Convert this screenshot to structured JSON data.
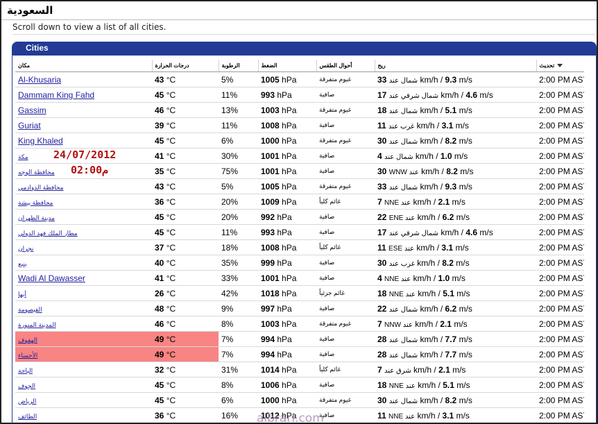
{
  "page": {
    "title": "السعودية",
    "notice": "Scroll down to view a list of all cities.",
    "panel_title": "Cities"
  },
  "columns": {
    "city": "مكان",
    "temp": "درجات الحرارة",
    "humidity": "الرطوبة",
    "pressure": "الضغط",
    "weather": "أحوال الطقس",
    "wind": "ريح",
    "updated": "تحديث"
  },
  "overlay": {
    "date": "24/07/2012",
    "time": "02:00م"
  },
  "watermark": "albrari.com",
  "colors": {
    "panel_header": "#233b95",
    "highlight": "#f88484",
    "link": "#2121a0",
    "overlay_text": "#b01010"
  },
  "rows": [
    {
      "city": "Al-Khusaria",
      "arabic": false,
      "temp": "43",
      "humidity": "5%",
      "pressure": "1005",
      "weather": "غيوم متفرقة",
      "wind_dir": "شمال عند",
      "wind_kmh": "33",
      "wind_ms": "9.3",
      "updated": "2:00 PM AST",
      "highlight": false
    },
    {
      "city": "Dammam King Fahd",
      "arabic": false,
      "temp": "45",
      "humidity": "11%",
      "pressure": "993",
      "weather": "صافية",
      "wind_dir": "شمال شرقي عند",
      "wind_kmh": "17",
      "wind_ms": "4.6",
      "updated": "2:00 PM AST",
      "highlight": false
    },
    {
      "city": "Gassim",
      "arabic": false,
      "temp": "46",
      "humidity": "13%",
      "pressure": "1003",
      "weather": "غيوم متفرقة",
      "wind_dir": "شمال عند",
      "wind_kmh": "18",
      "wind_ms": "5.1",
      "updated": "2:00 PM AST",
      "highlight": false
    },
    {
      "city": "Guriat",
      "arabic": false,
      "temp": "39",
      "humidity": "11%",
      "pressure": "1008",
      "weather": "صافية",
      "wind_dir": "غرب عند",
      "wind_kmh": "11",
      "wind_ms": "3.1",
      "updated": "2:00 PM AST",
      "highlight": false
    },
    {
      "city": "King Khaled",
      "arabic": false,
      "temp": "45",
      "humidity": "6%",
      "pressure": "1000",
      "weather": "غيوم متفرقة",
      "wind_dir": "شمال عند",
      "wind_kmh": "30",
      "wind_ms": "8.2",
      "updated": "2:00 PM AST",
      "highlight": false
    },
    {
      "city": "مكة",
      "arabic": true,
      "temp": "41",
      "humidity": "30%",
      "pressure": "1001",
      "weather": "صافية",
      "wind_dir": "شمال عند",
      "wind_kmh": "4",
      "wind_ms": "1.0",
      "updated": "2:00 PM AST",
      "highlight": false
    },
    {
      "city": "محافظة الوجه",
      "arabic": true,
      "temp": "35",
      "humidity": "75%",
      "pressure": "1001",
      "weather": "صافية",
      "wind_dir": "WNW عند",
      "wind_kmh": "30",
      "wind_ms": "8.2",
      "updated": "2:00 PM AST",
      "highlight": false
    },
    {
      "city": "محافظة الدوادمي",
      "arabic": true,
      "temp": "43",
      "humidity": "5%",
      "pressure": "1005",
      "weather": "غيوم متفرقة",
      "wind_dir": "شمال عند",
      "wind_kmh": "33",
      "wind_ms": "9.3",
      "updated": "2:00 PM AST",
      "highlight": false
    },
    {
      "city": "محافظة بيشة",
      "arabic": true,
      "temp": "36",
      "humidity": "20%",
      "pressure": "1009",
      "weather": "غائم كلياً",
      "wind_dir": "NNE عند",
      "wind_kmh": "7",
      "wind_ms": "2.1",
      "updated": "2:00 PM AST",
      "highlight": false
    },
    {
      "city": "مدينة الظهران",
      "arabic": true,
      "temp": "45",
      "humidity": "20%",
      "pressure": "992",
      "weather": "صافية",
      "wind_dir": "ENE عند",
      "wind_kmh": "22",
      "wind_ms": "6.2",
      "updated": "2:00 PM AST",
      "highlight": false
    },
    {
      "city": "مطار الملك فهد الدولي",
      "arabic": true,
      "temp": "45",
      "humidity": "11%",
      "pressure": "993",
      "weather": "صافية",
      "wind_dir": "شمال شرقي عند",
      "wind_kmh": "17",
      "wind_ms": "4.6",
      "updated": "2:00 PM AST",
      "highlight": false
    },
    {
      "city": "نجران",
      "arabic": true,
      "temp": "37",
      "humidity": "18%",
      "pressure": "1008",
      "weather": "غائم كلياً",
      "wind_dir": "ESE عند",
      "wind_kmh": "11",
      "wind_ms": "3.1",
      "updated": "2:00 PM AST",
      "highlight": false
    },
    {
      "city": "ينبع",
      "arabic": true,
      "temp": "40",
      "humidity": "35%",
      "pressure": "999",
      "weather": "صافية",
      "wind_dir": "غرب عند",
      "wind_kmh": "30",
      "wind_ms": "8.2",
      "updated": "2:00 PM AST",
      "highlight": false
    },
    {
      "city": "Wadi Al Dawasser",
      "arabic": false,
      "temp": "41",
      "humidity": "33%",
      "pressure": "1001",
      "weather": "صافية",
      "wind_dir": "NNE عند",
      "wind_kmh": "4",
      "wind_ms": "1.0",
      "updated": "2:00 PM AST",
      "highlight": false
    },
    {
      "city": "أبها",
      "arabic": true,
      "temp": "26",
      "humidity": "42%",
      "pressure": "1018",
      "weather": "غائم جزئياً",
      "wind_dir": "NNE عند",
      "wind_kmh": "18",
      "wind_ms": "5.1",
      "updated": "2:00 PM AST",
      "highlight": false
    },
    {
      "city": "القيصومة",
      "arabic": true,
      "temp": "48",
      "humidity": "9%",
      "pressure": "997",
      "weather": "صافية",
      "wind_dir": "شمال عند",
      "wind_kmh": "22",
      "wind_ms": "6.2",
      "updated": "2:00 PM AST",
      "highlight": false
    },
    {
      "city": "المدينة المنورة",
      "arabic": true,
      "temp": "46",
      "humidity": "8%",
      "pressure": "1003",
      "weather": "غيوم متفرقة",
      "wind_dir": "NNW عند",
      "wind_kmh": "7",
      "wind_ms": "2.1",
      "updated": "2:00 PM AST",
      "highlight": false
    },
    {
      "city": "الهفوف",
      "arabic": true,
      "temp": "49",
      "humidity": "7%",
      "pressure": "994",
      "weather": "صافية",
      "wind_dir": "شمال عند",
      "wind_kmh": "28",
      "wind_ms": "7.7",
      "updated": "2:00 PM AST",
      "highlight": true
    },
    {
      "city": "الأحساء",
      "arabic": true,
      "temp": "49",
      "humidity": "7%",
      "pressure": "994",
      "weather": "صافية",
      "wind_dir": "شمال عند",
      "wind_kmh": "28",
      "wind_ms": "7.7",
      "updated": "2:00 PM AST",
      "highlight": true
    },
    {
      "city": "الباحة",
      "arabic": true,
      "temp": "32",
      "humidity": "31%",
      "pressure": "1014",
      "weather": "غائم كلياً",
      "wind_dir": "شرق عند",
      "wind_kmh": "7",
      "wind_ms": "2.1",
      "updated": "2:00 PM AST",
      "highlight": false
    },
    {
      "city": "الجوف",
      "arabic": true,
      "temp": "45",
      "humidity": "8%",
      "pressure": "1006",
      "weather": "صافية",
      "wind_dir": "NNE عند",
      "wind_kmh": "18",
      "wind_ms": "5.1",
      "updated": "2:00 PM AST",
      "highlight": false
    },
    {
      "city": "الرياض",
      "arabic": true,
      "temp": "45",
      "humidity": "6%",
      "pressure": "1000",
      "weather": "غيوم متفرقة",
      "wind_dir": "شمال عند",
      "wind_kmh": "30",
      "wind_ms": "8.2",
      "updated": "2:00 PM AST",
      "highlight": false
    },
    {
      "city": "الطائف",
      "arabic": true,
      "temp": "36",
      "humidity": "16%",
      "pressure": "1012",
      "weather": "صافية",
      "wind_dir": "NNE عند",
      "wind_kmh": "11",
      "wind_ms": "3.1",
      "updated": "2:00 PM AST",
      "highlight": false
    }
  ]
}
